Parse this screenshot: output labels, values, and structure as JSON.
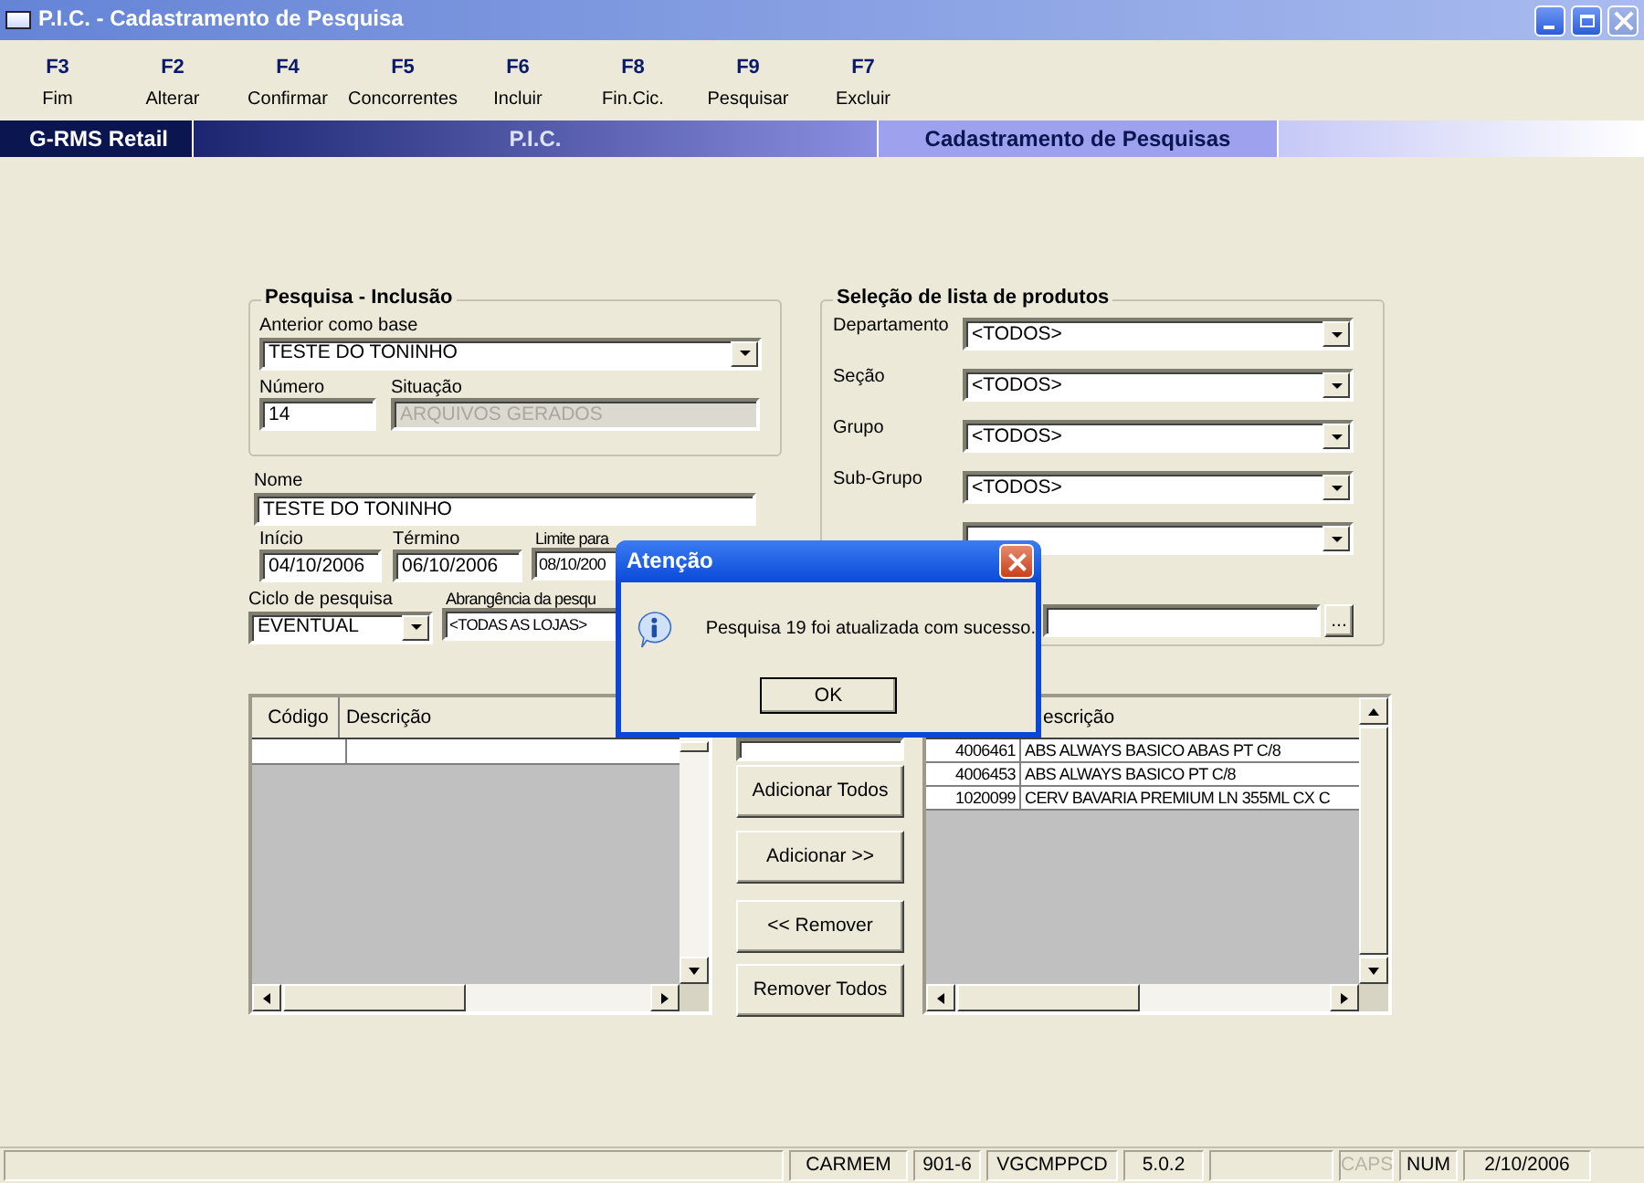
{
  "window": {
    "title": "P.I.C. - Cadastramento de Pesquisa"
  },
  "toolbar": [
    {
      "key": "F3",
      "label": "Fim"
    },
    {
      "key": "F2",
      "label": "Alterar"
    },
    {
      "key": "F4",
      "label": "Confirmar"
    },
    {
      "key": "F5",
      "label": "Concorrentes"
    },
    {
      "key": "F6",
      "label": "Incluir"
    },
    {
      "key": "F8",
      "label": "Fin.Cic."
    },
    {
      "key": "F9",
      "label": "Pesquisar"
    },
    {
      "key": "F7",
      "label": "Excluir"
    }
  ],
  "banner": {
    "product": "G-RMS Retail",
    "module": "P.I.C.",
    "screen": "Cadastramento de Pesquisas"
  },
  "search_group": {
    "title": "Pesquisa - Inclusão",
    "base": {
      "label": "Anterior como base",
      "value": "TESTE DO TONINHO"
    },
    "number": {
      "label": "Número",
      "value": "14"
    },
    "status": {
      "label": "Situação",
      "value": "ARQUIVOS GERADOS",
      "disabled": true
    }
  },
  "name": {
    "label": "Nome",
    "value": "TESTE DO TONINHO"
  },
  "dates": [
    {
      "label": "Início",
      "value": "04/10/2006"
    },
    {
      "label": "Término",
      "value": "06/10/2006"
    },
    {
      "label": "Limite para",
      "value": "08/10/200"
    }
  ],
  "cycle": {
    "label": "Ciclo de pesquisa",
    "value": "EVENTUAL"
  },
  "scope": {
    "label": "Abrangência da pesqu",
    "value": "<TODAS AS LOJAS>"
  },
  "product_group": {
    "title": "Seleção de lista de produtos",
    "filters": [
      {
        "label": "Departamento",
        "value": "<TODOS>"
      },
      {
        "label": "Seção",
        "value": "<TODOS>"
      },
      {
        "label": "Grupo",
        "value": "<TODOS>"
      },
      {
        "label": "Sub-Grupo",
        "value": "<TODOS>"
      },
      {
        "kind": "combo"
      }
    ],
    "browse_button": "..."
  },
  "available_grid": {
    "columns": [
      "Código",
      "Descrição"
    ]
  },
  "transfer_buttons": [
    "Adicionar Todos",
    "Adicionar >>",
    "<< Remover",
    "Remover Todos"
  ],
  "selected_grid": {
    "columns": [
      "escrição"
    ],
    "rows": [
      {
        "code": "4006461",
        "description": "ABS ALWAYS BASICO ABAS PT C/8"
      },
      {
        "code": "4006453",
        "description": "ABS ALWAYS BASICO PT C/8"
      },
      {
        "code": "1020099",
        "description": "CERV BAVARIA PREMIUM LN 355ML CX C"
      }
    ]
  },
  "dialog": {
    "title": "Atenção",
    "message": "Pesquisa 19 foi atualizada com sucesso.",
    "button": "OK"
  },
  "status_bar": [
    {
      "text": "CARMEM",
      "disabled": false
    },
    {
      "text": "901-6",
      "disabled": false
    },
    {
      "text": "VGCMPPCD",
      "disabled": false
    },
    {
      "text": "5.0.2",
      "disabled": false
    },
    {
      "kind": "blank"
    },
    {
      "text": "CAPS",
      "disabled": true
    },
    {
      "text": "NUM",
      "disabled": false
    },
    {
      "text": "2/10/2006",
      "disabled": false
    }
  ]
}
